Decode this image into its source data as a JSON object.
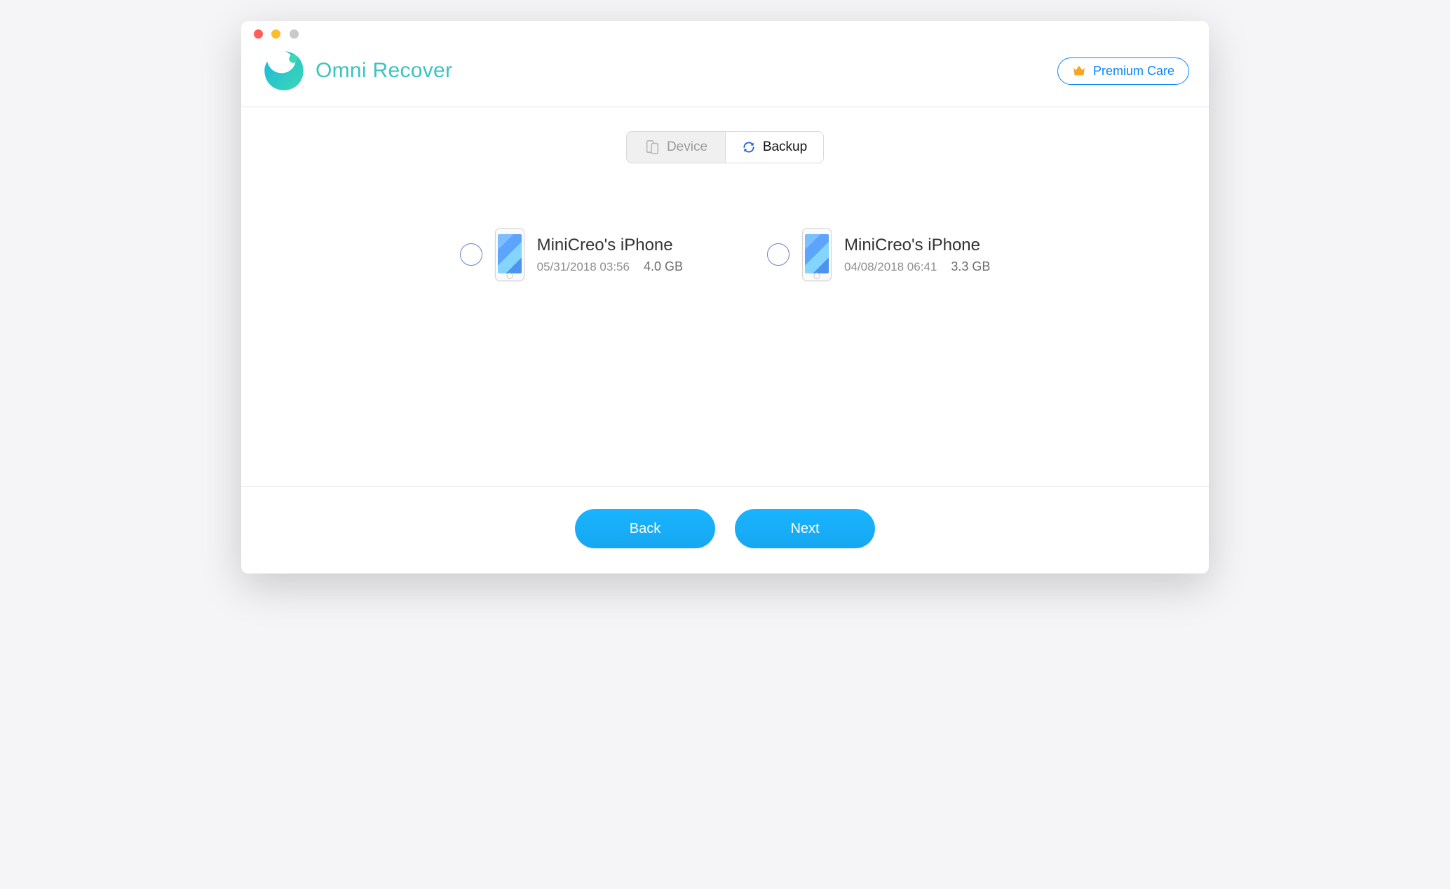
{
  "app": {
    "name": "Omni Recover"
  },
  "header": {
    "premium_label": "Premium Care"
  },
  "tabs": {
    "device_label": "Device",
    "backup_label": "Backup",
    "active": "backup"
  },
  "backups": [
    {
      "name": "MiniCreo's iPhone",
      "date": "05/31/2018 03:56",
      "size": "4.0 GB"
    },
    {
      "name": "MiniCreo's iPhone",
      "date": "04/08/2018 06:41",
      "size": "3.3 GB"
    }
  ],
  "footer": {
    "back_label": "Back",
    "next_label": "Next"
  },
  "icons": {
    "crown": "crown-icon",
    "device": "device-icon",
    "refresh": "refresh-icon",
    "phone": "phone-icon"
  }
}
